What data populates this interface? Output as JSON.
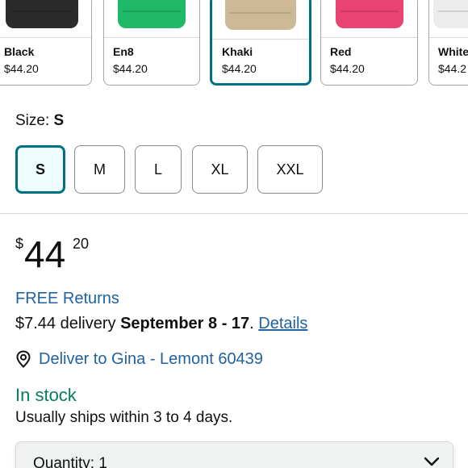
{
  "swatches": [
    {
      "name": "Black",
      "price": "$44.20",
      "color": "#2b2b2b",
      "selected": false
    },
    {
      "name": "En8",
      "price": "$44.20",
      "color": "#1fb866",
      "selected": false
    },
    {
      "name": "Khaki",
      "price": "$44.20",
      "color": "#cdb998",
      "selected": true
    },
    {
      "name": "Red",
      "price": "$44.20",
      "color": "#e94373",
      "selected": false
    },
    {
      "name": "White",
      "price": "$44.2",
      "color": "#ececec",
      "selected": false
    }
  ],
  "size": {
    "label": "Size:",
    "selected": "S",
    "options": [
      "S",
      "M",
      "L",
      "XL",
      "XXL"
    ]
  },
  "price": {
    "symbol": "$",
    "whole": "44",
    "fraction": "20"
  },
  "returns": "FREE Returns",
  "delivery": {
    "prefix": "$7.44 delivery",
    "dates": "September 8 - 17",
    "separator": ".",
    "details_link": "Details"
  },
  "deliver_to": {
    "text": "Deliver to Gina - Lemont 60439",
    "icon": "location-pin-icon"
  },
  "stock": {
    "status": "In stock",
    "shipping_note": "Usually ships within 3 to 4 days."
  },
  "quantity": {
    "label": "Quantity: 1",
    "icon": "chevron-down-icon"
  },
  "colors": {
    "accent_teal": "#007185",
    "link_blue": "#2162a1",
    "stock_green": "#067d62"
  }
}
